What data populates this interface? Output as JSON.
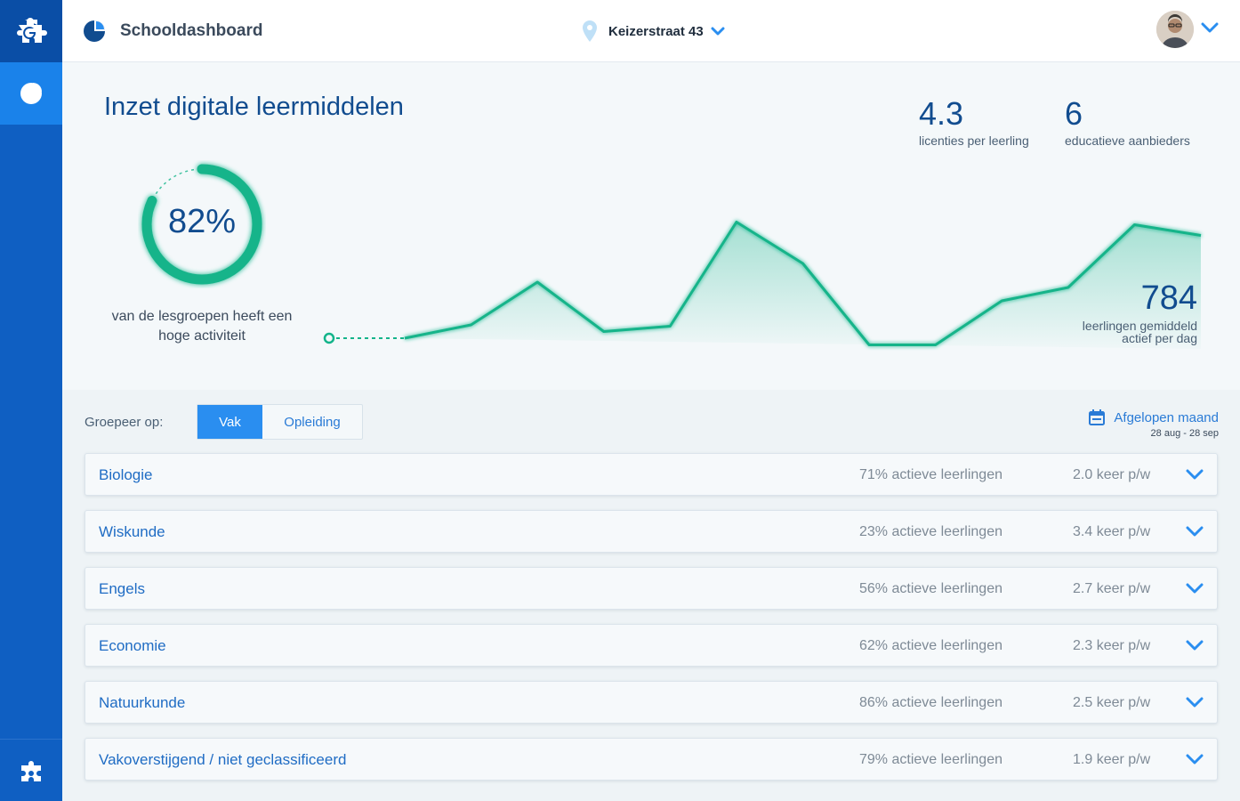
{
  "header": {
    "title": "Schooldashboard",
    "location": "Keizerstraat 43"
  },
  "hero": {
    "title": "Inzet digitale leermiddelen",
    "stats": [
      {
        "value": "4.3",
        "label": "licenties per leerling"
      },
      {
        "value": "6",
        "label": "educatieve aanbieders"
      }
    ],
    "ring": {
      "value": "82%",
      "fraction": 0.82,
      "label": "van de lesgroepen heeft een hoge activiteit"
    },
    "daily": {
      "value": "784",
      "label": "leerlingen gemiddeld\nactief  per dag"
    },
    "sparkline": [
      0.0,
      0.1,
      0.42,
      0.05,
      0.09,
      0.87,
      0.56,
      -0.05,
      -0.05,
      0.28,
      0.38,
      0.85,
      0.77
    ]
  },
  "filter": {
    "group_label": "Groepeer op:",
    "options": [
      "Vak",
      "Opleiding"
    ],
    "selected": "Vak",
    "period_label": "Afgelopen maand",
    "period_range": "28 aug - 28 sep"
  },
  "subjects": [
    {
      "name": "Biologie",
      "active": "71% actieve leerlingen",
      "freq": "2.0 keer p/w"
    },
    {
      "name": "Wiskunde",
      "active": "23% actieve leerlingen",
      "freq": "3.4 keer p/w"
    },
    {
      "name": "Engels",
      "active": "56% actieve leerlingen",
      "freq": "2.7 keer p/w"
    },
    {
      "name": "Economie",
      "active": "62% actieve leerlingen",
      "freq": "2.3 keer p/w"
    },
    {
      "name": "Natuurkunde",
      "active": "86% actieve leerlingen",
      "freq": "2.5 keer p/w"
    },
    {
      "name": "Vakoverstijgend / niet geclassificeerd",
      "active": "79% actieve leerlingen",
      "freq": "1.9 keer p/w"
    }
  ],
  "colors": {
    "brand": "#0f5fc2",
    "accent": "#2a8ef0",
    "teal": "#13b48a"
  }
}
